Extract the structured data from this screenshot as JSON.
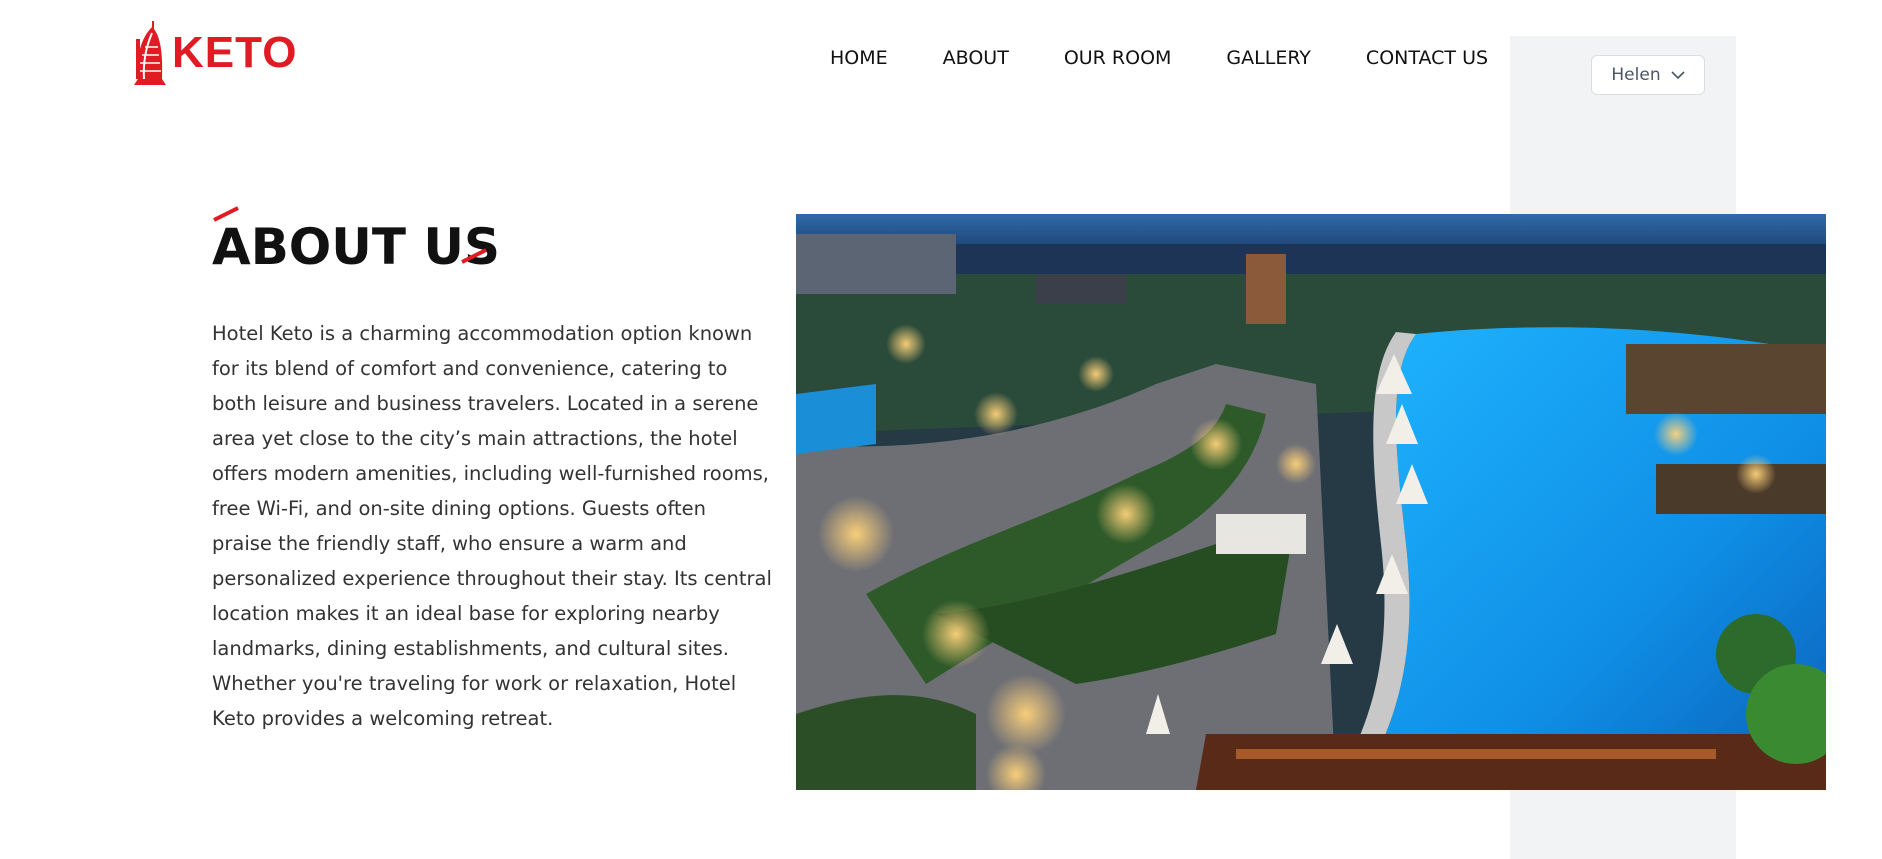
{
  "brand": {
    "logo_text": "KETO",
    "accent_color": "#e01b24"
  },
  "nav": {
    "items": [
      {
        "label": "HOME"
      },
      {
        "label": "ABOUT"
      },
      {
        "label": "OUR ROOM"
      },
      {
        "label": "GALLERY"
      },
      {
        "label": "CONTACT US"
      }
    ]
  },
  "user_menu": {
    "name": "Helen",
    "icon": "chevron-down-icon"
  },
  "about": {
    "title": "ABOUT US",
    "body": "Hotel Keto is a charming accommodation option known for its blend of comfort and convenience, catering to both leisure and business travelers. Located in a serene area yet close to the city’s main attractions, the hotel offers modern amenities, including well-furnished rooms, free Wi-Fi, and on-site dining options. Guests often praise the friendly staff, who ensure a warm and personalized experience throughout their stay. Its central location makes it an ideal base for exploring nearby landmarks, dining establishments, and cultural sites. Whether you're traveling for work or relaxation, Hotel Keto provides a welcoming retreat."
  },
  "colors": {
    "side_panel": "#f2f3f5",
    "text": "#111111",
    "body_text": "#333333"
  }
}
